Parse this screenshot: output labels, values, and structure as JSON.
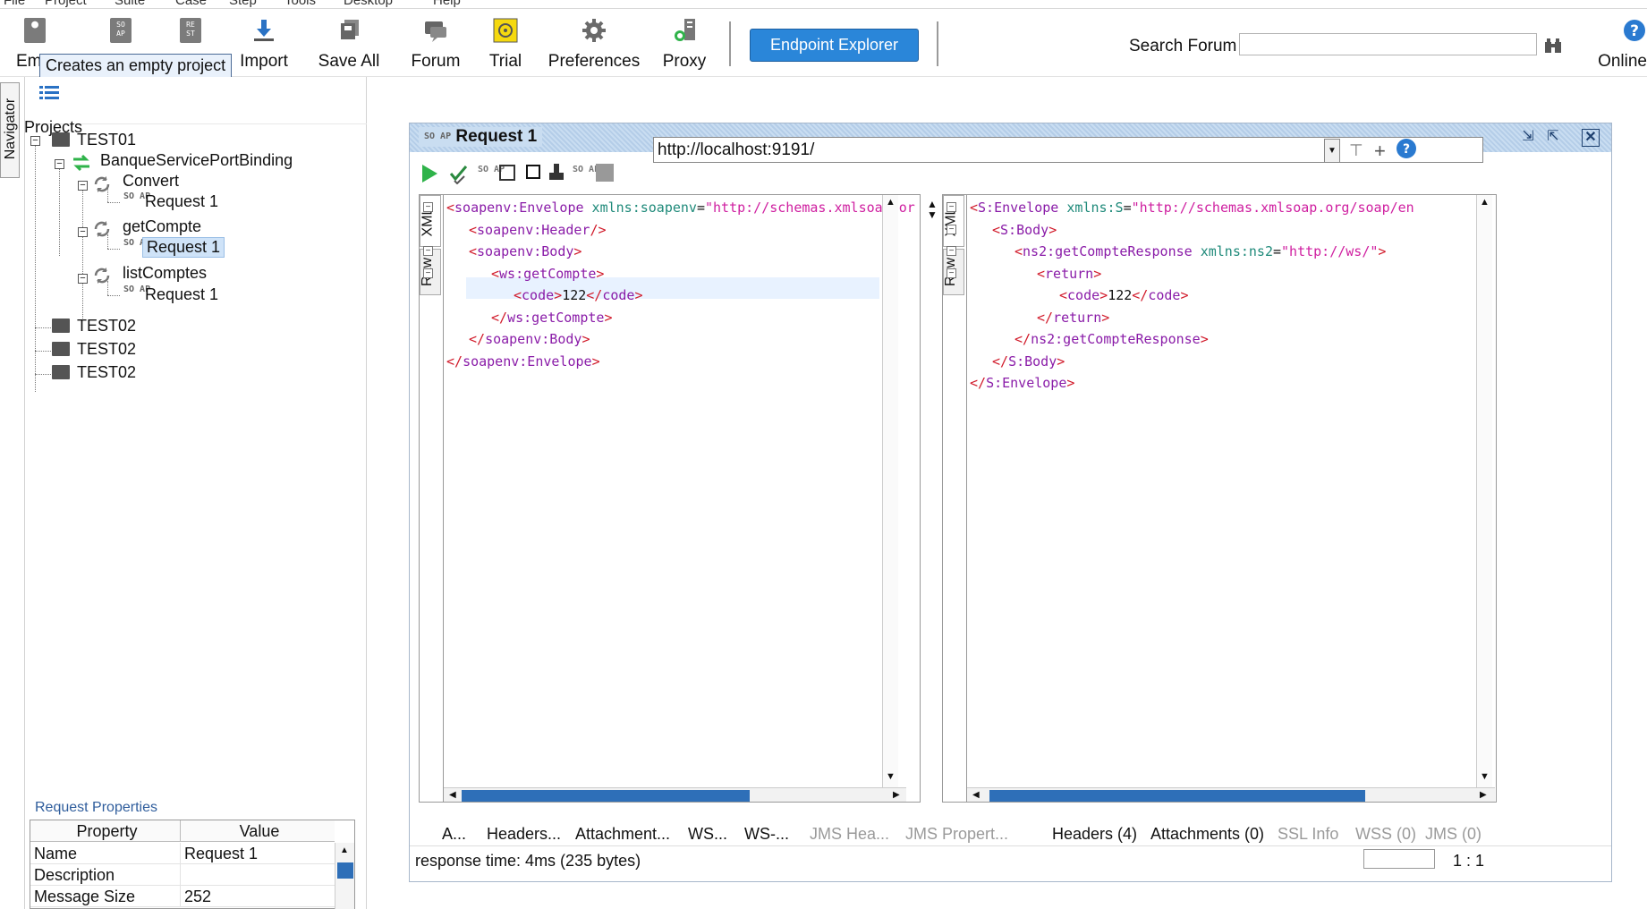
{
  "menubar": [
    "File",
    "Project",
    "Suite",
    "Case",
    "Step",
    "Tools",
    "Desktop",
    "Help"
  ],
  "toolbar": {
    "empty_label": "Empty",
    "tooltip": "Creates an empty project",
    "buttons": [
      {
        "label": "Import",
        "icon": "import-icon"
      },
      {
        "label": "Save All",
        "icon": "save-all-icon"
      },
      {
        "label": "Forum",
        "icon": "forum-icon"
      },
      {
        "label": "Trial",
        "icon": "trial-icon"
      },
      {
        "label": "Preferences",
        "icon": "gear-icon"
      },
      {
        "label": "Proxy",
        "icon": "proxy-icon"
      }
    ],
    "endpoint_explorer": "Endpoint Explorer",
    "search_label": "Search Forum",
    "search_value": "",
    "online_label": "Online",
    "soap_icon_text": "SO AP",
    "rest_icon_text": "RE ST"
  },
  "navigator": {
    "tab_label": "Navigator",
    "root_label": "Projects",
    "tree": {
      "test01": "TEST01",
      "binding": "BanqueServicePortBinding",
      "op_convert": "Convert",
      "op_convert_req": "Request 1",
      "op_getcompte": "getCompte",
      "op_getcompte_req": "Request 1",
      "op_listcomptes": "listComptes",
      "op_listcomptes_req": "Request 1",
      "test02a": "TEST02",
      "test02b": "TEST02",
      "test02c": "TEST02"
    },
    "soap_icon_text": "SO AP"
  },
  "request_properties": {
    "title": "Request Properties",
    "headers": [
      "Property",
      "Value"
    ],
    "rows": [
      {
        "property": "Name",
        "value": "Request 1"
      },
      {
        "property": "Description",
        "value": ""
      },
      {
        "property": "Message Size",
        "value": "252"
      }
    ]
  },
  "request_window": {
    "title": "Request 1",
    "soap_icon_text": "SO AP",
    "url": "http://localhost:9191/",
    "left_tabs": [
      "XML",
      "Raw"
    ],
    "right_tabs": [
      "XML",
      "Raw"
    ],
    "request_lines": [
      {
        "indent": 0,
        "fold": "-",
        "segments": [
          [
            "tg",
            "<"
          ],
          [
            "nm",
            "soapenv:Envelope"
          ],
          [
            "at",
            " xmlns:soapenv"
          ],
          [
            "tx",
            "="
          ],
          [
            "vl",
            "\"http://schemas.xmlsoap.or"
          ]
        ]
      },
      {
        "indent": 1,
        "fold": "",
        "segments": [
          [
            "tg",
            "<"
          ],
          [
            "nm",
            "soapenv:Header"
          ],
          [
            "tg",
            "/>"
          ]
        ]
      },
      {
        "indent": 1,
        "fold": "-",
        "segments": [
          [
            "tg",
            "<"
          ],
          [
            "nm",
            "soapenv:Body"
          ],
          [
            "tg",
            ">"
          ]
        ]
      },
      {
        "indent": 2,
        "fold": "-",
        "segments": [
          [
            "tg",
            "<"
          ],
          [
            "nm",
            "ws:getCompte"
          ],
          [
            "tg",
            ">"
          ]
        ]
      },
      {
        "indent": 3,
        "fold": "",
        "segments": [
          [
            "tg",
            "<"
          ],
          [
            "nm",
            "code"
          ],
          [
            "tg",
            ">"
          ],
          [
            "tx",
            "122"
          ],
          [
            "tg",
            "</"
          ],
          [
            "nm",
            "code"
          ],
          [
            "tg",
            ">"
          ]
        ]
      },
      {
        "indent": 2,
        "fold": "",
        "segments": [
          [
            "tg",
            "</"
          ],
          [
            "nm",
            "ws:getCompte"
          ],
          [
            "tg",
            ">"
          ]
        ]
      },
      {
        "indent": 1,
        "fold": "",
        "segments": [
          [
            "tg",
            "</"
          ],
          [
            "nm",
            "soapenv:Body"
          ],
          [
            "tg",
            ">"
          ]
        ]
      },
      {
        "indent": 0,
        "fold": "",
        "segments": [
          [
            "tg",
            "</"
          ],
          [
            "nm",
            "soapenv:Envelope"
          ],
          [
            "tg",
            ">"
          ]
        ]
      }
    ],
    "response_lines": [
      {
        "indent": 0,
        "fold": "-",
        "segments": [
          [
            "tg",
            "<"
          ],
          [
            "nm",
            "S:Envelope"
          ],
          [
            "at",
            " xmlns:S"
          ],
          [
            "tx",
            "="
          ],
          [
            "vl",
            "\"http://schemas.xmlsoap.org/soap/en"
          ]
        ]
      },
      {
        "indent": 1,
        "fold": "-",
        "segments": [
          [
            "tg",
            "<"
          ],
          [
            "nm",
            "S:Body"
          ],
          [
            "tg",
            ">"
          ]
        ]
      },
      {
        "indent": 2,
        "fold": "-",
        "segments": [
          [
            "tg",
            "<"
          ],
          [
            "nm",
            "ns2:getCompteResponse"
          ],
          [
            "at",
            " xmlns:ns2"
          ],
          [
            "tx",
            "="
          ],
          [
            "vl",
            "\"http://ws/\""
          ],
          [
            "tg",
            ">"
          ]
        ]
      },
      {
        "indent": 3,
        "fold": "-",
        "segments": [
          [
            "tg",
            "<"
          ],
          [
            "nm",
            "return"
          ],
          [
            "tg",
            ">"
          ]
        ]
      },
      {
        "indent": 4,
        "fold": "",
        "segments": [
          [
            "tg",
            "<"
          ],
          [
            "nm",
            "code"
          ],
          [
            "tg",
            ">"
          ],
          [
            "tx",
            "122"
          ],
          [
            "tg",
            "</"
          ],
          [
            "nm",
            "code"
          ],
          [
            "tg",
            ">"
          ]
        ]
      },
      {
        "indent": 3,
        "fold": "",
        "segments": [
          [
            "tg",
            "</"
          ],
          [
            "nm",
            "return"
          ],
          [
            "tg",
            ">"
          ]
        ]
      },
      {
        "indent": 2,
        "fold": "",
        "segments": [
          [
            "tg",
            "</"
          ],
          [
            "nm",
            "ns2:getCompteResponse"
          ],
          [
            "tg",
            ">"
          ]
        ]
      },
      {
        "indent": 1,
        "fold": "",
        "segments": [
          [
            "tg",
            "</"
          ],
          [
            "nm",
            "S:Body"
          ],
          [
            "tg",
            ">"
          ]
        ]
      },
      {
        "indent": 0,
        "fold": "",
        "segments": [
          [
            "tg",
            "</"
          ],
          [
            "nm",
            "S:Envelope"
          ],
          [
            "tg",
            ">"
          ]
        ]
      }
    ],
    "request_tabs": [
      {
        "label": "A...",
        "enabled": true
      },
      {
        "label": "Headers...",
        "enabled": true
      },
      {
        "label": "Attachment...",
        "enabled": true
      },
      {
        "label": "WS...",
        "enabled": true
      },
      {
        "label": "WS-...",
        "enabled": true
      },
      {
        "label": "JMS Hea...",
        "enabled": false
      },
      {
        "label": "JMS Propert...",
        "enabled": false
      }
    ],
    "response_tabs": [
      {
        "label": "Headers (4)",
        "enabled": true
      },
      {
        "label": "Attachments (0)",
        "enabled": true
      },
      {
        "label": "SSL Info",
        "enabled": false
      },
      {
        "label": "WSS (0)",
        "enabled": false
      },
      {
        "label": "JMS (0)",
        "enabled": false
      }
    ],
    "status": "response time: 4ms (235 bytes)",
    "cursor_pos": "1 : 1"
  },
  "colors": {
    "accent": "#2a86d9",
    "title_bar": "#c9ddf1",
    "selected": "#cfe3f8",
    "scroll_thumb": "#2e6fb8"
  }
}
